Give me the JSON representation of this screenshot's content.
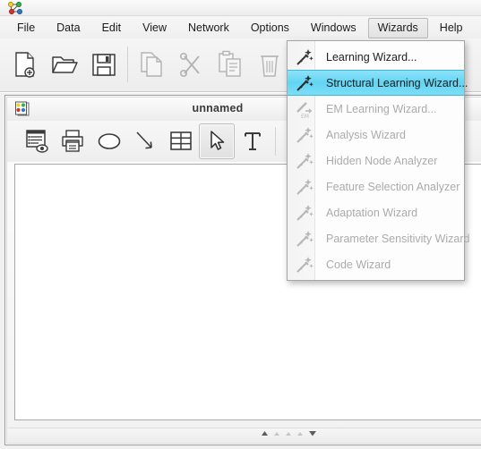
{
  "window": {
    "app_icon": "network-graph-icon",
    "title": ""
  },
  "menubar": {
    "items": [
      {
        "label": "File",
        "name": "menu-file",
        "open": false
      },
      {
        "label": "Data",
        "name": "menu-data",
        "open": false
      },
      {
        "label": "Edit",
        "name": "menu-edit",
        "open": false
      },
      {
        "label": "View",
        "name": "menu-view",
        "open": false
      },
      {
        "label": "Network",
        "name": "menu-network",
        "open": false
      },
      {
        "label": "Options",
        "name": "menu-options",
        "open": false
      },
      {
        "label": "Windows",
        "name": "menu-windows",
        "open": false
      },
      {
        "label": "Wizards",
        "name": "menu-wizards",
        "open": true
      },
      {
        "label": "Help",
        "name": "menu-help",
        "open": false
      }
    ]
  },
  "toolbar": {
    "buttons": [
      {
        "icon": "new-document-icon",
        "name": "toolbar-new",
        "enabled": true
      },
      {
        "icon": "open-folder-icon",
        "name": "toolbar-open",
        "enabled": true
      },
      {
        "icon": "save-floppy-icon",
        "name": "toolbar-save",
        "enabled": true
      },
      {
        "icon": "copy-pages-icon",
        "name": "toolbar-copy",
        "enabled": false
      },
      {
        "icon": "scissors-cut-icon",
        "name": "toolbar-cut",
        "enabled": false
      },
      {
        "icon": "clipboard-paste-icon",
        "name": "toolbar-paste",
        "enabled": false
      },
      {
        "icon": "trash-delete-icon",
        "name": "toolbar-delete",
        "enabled": false
      }
    ]
  },
  "document_window": {
    "icon": "network-document-icon",
    "title": "unnamed",
    "toolbar": [
      {
        "icon": "report-view-icon",
        "name": "doc-tool-report",
        "active": false
      },
      {
        "icon": "printer-icon",
        "name": "doc-tool-print",
        "active": false
      },
      {
        "icon": "ellipse-node-icon",
        "name": "doc-tool-node",
        "active": false
      },
      {
        "icon": "arrow-arc-icon",
        "name": "doc-tool-arc",
        "active": false
      },
      {
        "icon": "grid-table-icon",
        "name": "doc-tool-table",
        "active": false
      },
      {
        "icon": "select-cursor-icon",
        "name": "doc-tool-select",
        "active": true
      },
      {
        "icon": "text-tool-icon",
        "name": "doc-tool-text",
        "active": false
      },
      {
        "icon": "lightning-icon",
        "name": "doc-tool-lightning",
        "active": false
      }
    ],
    "status_nav": [
      {
        "icon": "nav-up-icon",
        "name": "nav-scroll-up",
        "dim": false
      },
      {
        "icon": "nav-small-1-icon",
        "name": "nav-step-back",
        "dim": true
      },
      {
        "icon": "nav-small-2-icon",
        "name": "nav-step-mid",
        "dim": true
      },
      {
        "icon": "nav-small-3-icon",
        "name": "nav-step-forward",
        "dim": true
      },
      {
        "icon": "nav-down-icon",
        "name": "nav-scroll-down",
        "dim": false
      }
    ]
  },
  "dropdown": {
    "name": "wizards-menu",
    "items": [
      {
        "label": "Learning Wizard...",
        "icon": "magic-wand-icon",
        "enabled": true,
        "selected": false
      },
      {
        "label": "Structural Learning Wizard...",
        "icon": "magic-wand-icon",
        "enabled": true,
        "selected": true
      },
      {
        "label": "EM Learning Wizard...",
        "icon": "em-wand-icon",
        "enabled": false,
        "selected": false
      },
      {
        "label": "Analysis Wizard",
        "icon": "magic-wand-icon",
        "enabled": false,
        "selected": false
      },
      {
        "label": "Hidden Node Analyzer",
        "icon": "magic-wand-icon",
        "enabled": false,
        "selected": false
      },
      {
        "label": "Feature Selection Analyzer",
        "icon": "magic-wand-icon",
        "enabled": false,
        "selected": false
      },
      {
        "label": "Adaptation Wizard",
        "icon": "magic-wand-icon",
        "enabled": false,
        "selected": false
      },
      {
        "label": "Parameter Sensitivity Wizard",
        "icon": "magic-wand-icon",
        "enabled": false,
        "selected": false
      },
      {
        "label": "Code Wizard",
        "icon": "magic-wand-icon",
        "enabled": false,
        "selected": false
      }
    ]
  },
  "colors": {
    "selection_blue": "#61d5f4",
    "selection_border": "#37b9e0",
    "menu_bg": "#fdfdfd",
    "disabled_text": "#ababab",
    "text": "#1d1d1d",
    "chrome_bg": "#f0f0f0"
  }
}
